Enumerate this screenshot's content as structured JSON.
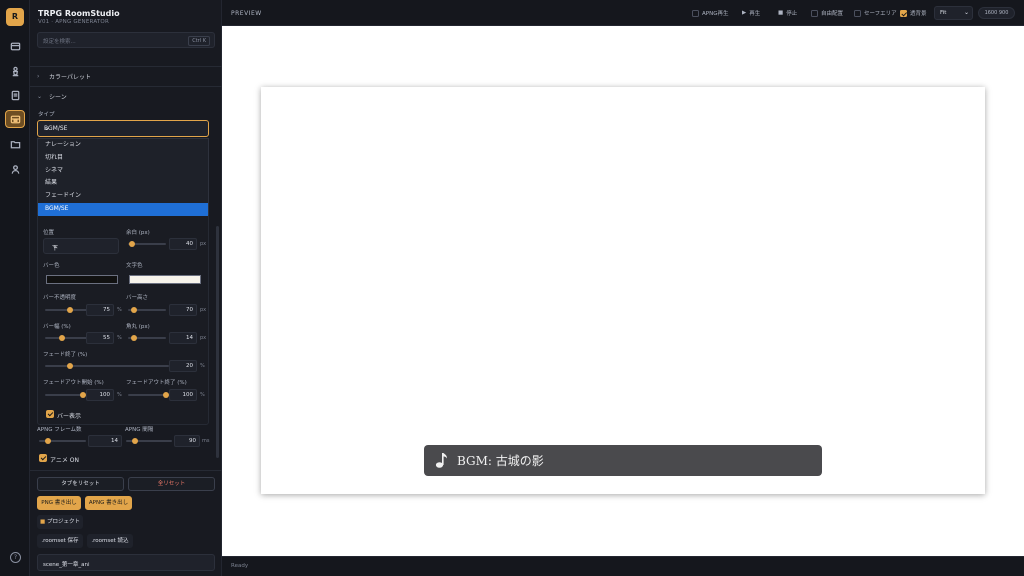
{
  "app": {
    "logo_letter": "R",
    "title": "TRPG RoomStudio",
    "subtitle": "V01 · APNG GENERATOR"
  },
  "search": {
    "placeholder": "設定を検索...",
    "shortcut": "Ctrl K"
  },
  "sections": {
    "palette": "カラーパレット",
    "scene": "シーン"
  },
  "type_field": {
    "label": "タイプ",
    "selected": "BGM/SE",
    "options": [
      "ナレーション",
      "切れ目",
      "シネマ",
      "結果",
      "フェードイン",
      "BGM/SE"
    ]
  },
  "position": {
    "label": "位置",
    "value": "下"
  },
  "margin": {
    "label": "余白 (px)",
    "value": "40",
    "unit": "px",
    "level": 0.1
  },
  "bar_color": {
    "label": "バー色",
    "color": "#111111"
  },
  "text_color": {
    "label": "文字色",
    "color": "#f7f3ea"
  },
  "bar_opacity": {
    "label": "バー不透明度",
    "value": "75",
    "unit": "%",
    "level": 0.6
  },
  "bar_height": {
    "label": "バー高さ",
    "value": "70",
    "unit": "px",
    "level": 0.15
  },
  "bar_width": {
    "label": "バー幅 (%)",
    "value": "55",
    "unit": "%",
    "level": 0.4
  },
  "corner": {
    "label": "角丸 (px)",
    "value": "14",
    "unit": "px",
    "level": 0.15
  },
  "fade_end": {
    "label": "フェード終了 (%)",
    "value": "20",
    "unit": "%",
    "level": 0.2
  },
  "fadeout_start": {
    "label": "フェードアウト開始 (%)",
    "value": "100",
    "unit": "%",
    "level": 1.0
  },
  "fadeout_end": {
    "label": "フェードアウト終了 (%)",
    "value": "100",
    "unit": "%",
    "level": 1.0
  },
  "bar_visible": {
    "label": "バー表示",
    "checked": true
  },
  "apng_frames": {
    "label": "APNG フレーム数",
    "value": "14",
    "level": 0.2
  },
  "apng_interval": {
    "label": "APNG 間隔",
    "value": "90",
    "unit": "ms",
    "level": 0.2
  },
  "anim": {
    "label": "アニメ ON",
    "checked": true
  },
  "buttons": {
    "tab_reset": "タブをリセット",
    "all_reset": "全リセット",
    "png_export": "PNG 書き出し",
    "apng_export": "APNG 書き出し",
    "project": "プロジェクト",
    "save_roomset": ".roomset 保存",
    "load_roomset": ".roomset 読込"
  },
  "filename": "scene_第一章_ani",
  "topbar": {
    "preview": "PREVIEW",
    "apng_play": "APNG再生",
    "play": "再生",
    "stop": "停止",
    "free_place": "自由配置",
    "safe_area": "セーフエリア",
    "transparent_bg": "透背景",
    "fit": "Fit",
    "size": "1600 900"
  },
  "preview": {
    "bgm_text": "BGM: 古城の影"
  },
  "status": "Ready",
  "colors": {
    "accent": "#e2a54a",
    "selection": "#1f6fd6",
    "danger": "#f07a6a"
  }
}
